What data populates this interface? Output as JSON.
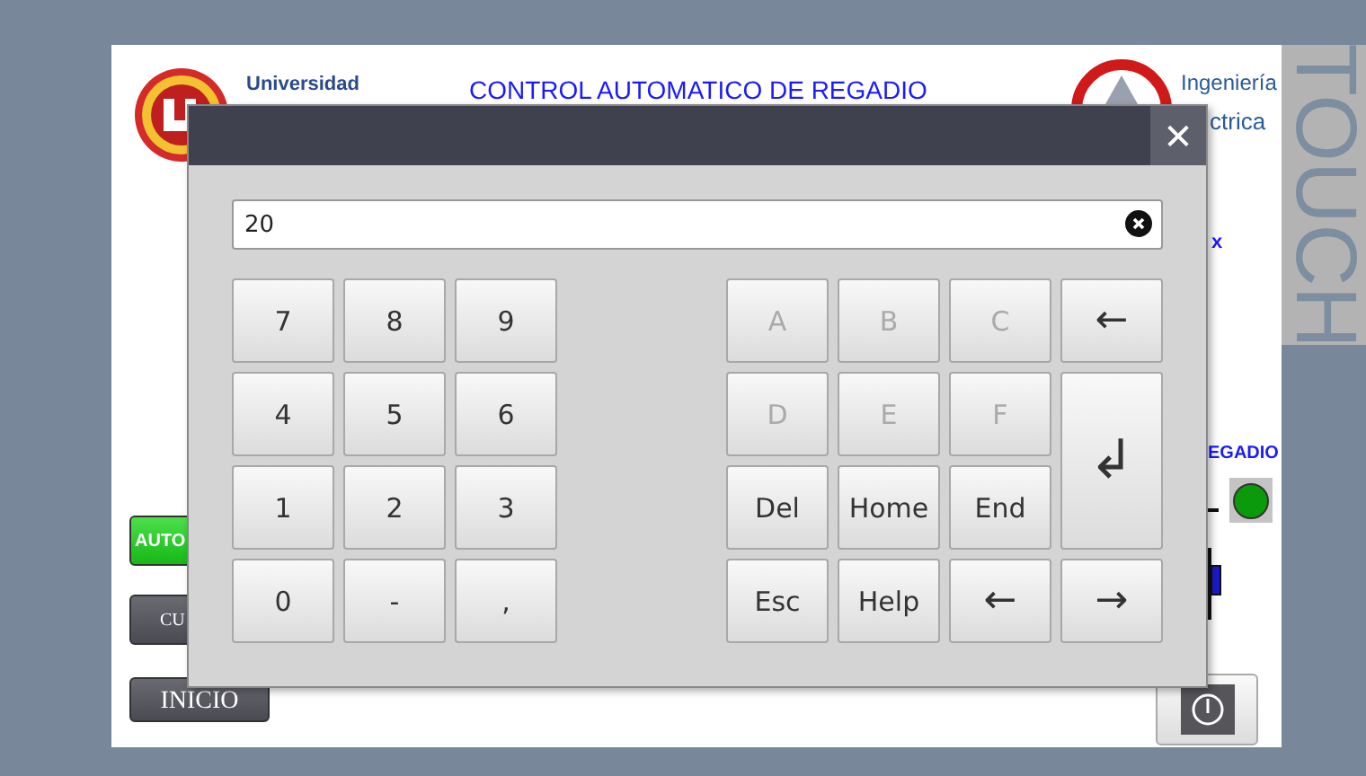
{
  "background": {
    "title": "CONTROL AUTOMATICO DE REGADIO",
    "logo_left_text": "Universidad",
    "logo_right_text_1": "Ingeniería",
    "logo_right_text_2": "ctrica",
    "side_label": "TOUCH",
    "label_x": "x",
    "label_regadio": "EGADIO",
    "indicator": {
      "on": true
    },
    "buttons": [
      {
        "label": "AUTO",
        "kind": "active"
      },
      {
        "label": "CU",
        "kind": "normal"
      },
      {
        "label": "INICIO",
        "kind": "normal"
      }
    ]
  },
  "dialog": {
    "close": "✕",
    "value": "20",
    "left_keys": [
      "7",
      "8",
      "9",
      "4",
      "5",
      "6",
      "1",
      "2",
      "3",
      "0",
      "-",
      ","
    ],
    "right_keys": [
      {
        "label": "A",
        "disabled": true,
        "kind": "key"
      },
      {
        "label": "B",
        "disabled": true,
        "kind": "key"
      },
      {
        "label": "C",
        "disabled": true,
        "kind": "key"
      },
      {
        "label": "←",
        "disabled": false,
        "kind": "key"
      },
      {
        "label": "D",
        "disabled": true,
        "kind": "key"
      },
      {
        "label": "E",
        "disabled": true,
        "kind": "key"
      },
      {
        "label": "F",
        "disabled": true,
        "kind": "key"
      },
      {
        "label": "↲",
        "disabled": false,
        "kind": "enter"
      },
      {
        "label": "Del",
        "disabled": false,
        "kind": "key"
      },
      {
        "label": "Home",
        "disabled": false,
        "kind": "key"
      },
      {
        "label": "End",
        "disabled": false,
        "kind": "key"
      },
      {
        "label": "Esc",
        "disabled": false,
        "kind": "key"
      },
      {
        "label": "Help",
        "disabled": false,
        "kind": "key"
      },
      {
        "label": "←",
        "disabled": false,
        "kind": "key"
      },
      {
        "label": "→",
        "disabled": false,
        "kind": "key"
      }
    ]
  }
}
